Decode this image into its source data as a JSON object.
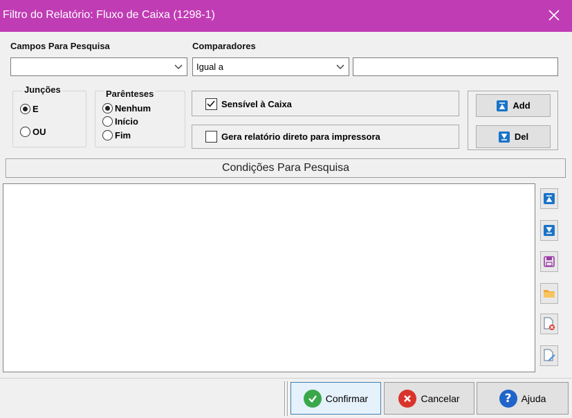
{
  "colors": {
    "title_bar": "#c03cb4",
    "accent_blue": "#1a73c8",
    "confirm_green": "#3aa84a",
    "cancel_red": "#d9342b",
    "help_blue": "#1f64c9"
  },
  "window": {
    "title": "Filtro do Relatório: Fluxo de Caixa (1298-1)",
    "close_icon": "close-icon"
  },
  "search": {
    "fields_label": "Campos Para Pesquisa",
    "fields_value": "",
    "comparators_label": "Comparadores",
    "comparator_value": "Igual a",
    "value_input": ""
  },
  "junctions": {
    "title": "Junções",
    "options": [
      "E",
      "OU"
    ],
    "selected": "E"
  },
  "parentheses": {
    "title": "Parênteses",
    "options": [
      "Nenhum",
      "Início",
      "Fim"
    ],
    "selected": "Nenhum"
  },
  "options": {
    "case_sensitive": {
      "label": "Sensível à Caixa",
      "checked": true
    },
    "direct_print": {
      "label": "Gera relatório direto para impressora",
      "checked": false
    }
  },
  "buttons": {
    "add": "Add",
    "del": "Del"
  },
  "conditions": {
    "header": "Condições Para Pesquisa",
    "items": []
  },
  "toolbar": [
    "move-up-icon",
    "move-down-icon",
    "save-icon",
    "open-folder-icon",
    "delete-file-icon",
    "edit-file-icon"
  ],
  "footer": {
    "confirm": "Confirmar",
    "cancel": "Cancelar",
    "help": "Ajuda"
  }
}
